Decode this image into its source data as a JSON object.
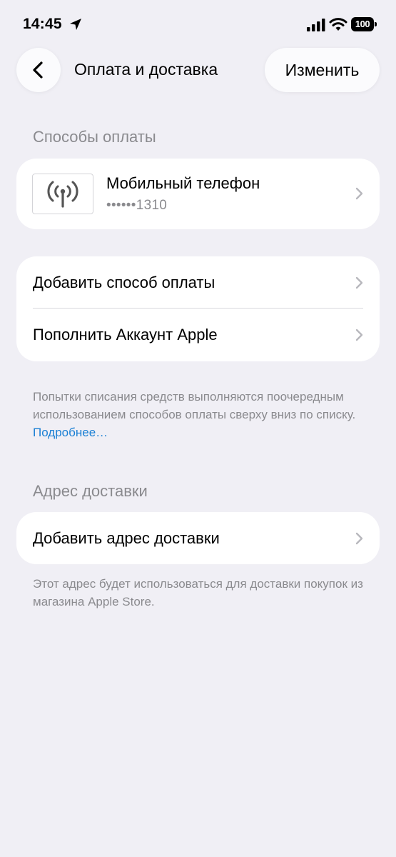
{
  "status_bar": {
    "time": "14:45",
    "battery": "100",
    "icons": [
      "location-arrow-icon",
      "cellular-signal-icon",
      "wifi-icon",
      "battery-icon"
    ]
  },
  "nav": {
    "back_icon": "chevron-left-icon",
    "title": "Оплата и доставка",
    "edit_label": "Изменить"
  },
  "payment_section": {
    "header": "Способы оплаты",
    "method": {
      "icon": "antenna-broadcast-icon",
      "title": "Мобильный телефон",
      "masked_number": "••••••1310"
    }
  },
  "payment_actions": [
    {
      "label": "Добавить способ оплаты"
    },
    {
      "label": "Пополнить Аккаунт Apple"
    }
  ],
  "payment_note": {
    "text": "Попытки списания средств выполняются поочередным использованием способов оплаты сверху вниз по списку. ",
    "link": "Подробнее…"
  },
  "shipping_section": {
    "header": "Адрес доставки",
    "add_label": "Добавить адрес доставки",
    "note": "Этот адрес будет использоваться для доставки покупок из магазина Apple Store."
  },
  "colors": {
    "background": "#f0eff5",
    "card": "#ffffff",
    "secondary_text": "#8a8a8e",
    "link": "#1a7fd4"
  }
}
